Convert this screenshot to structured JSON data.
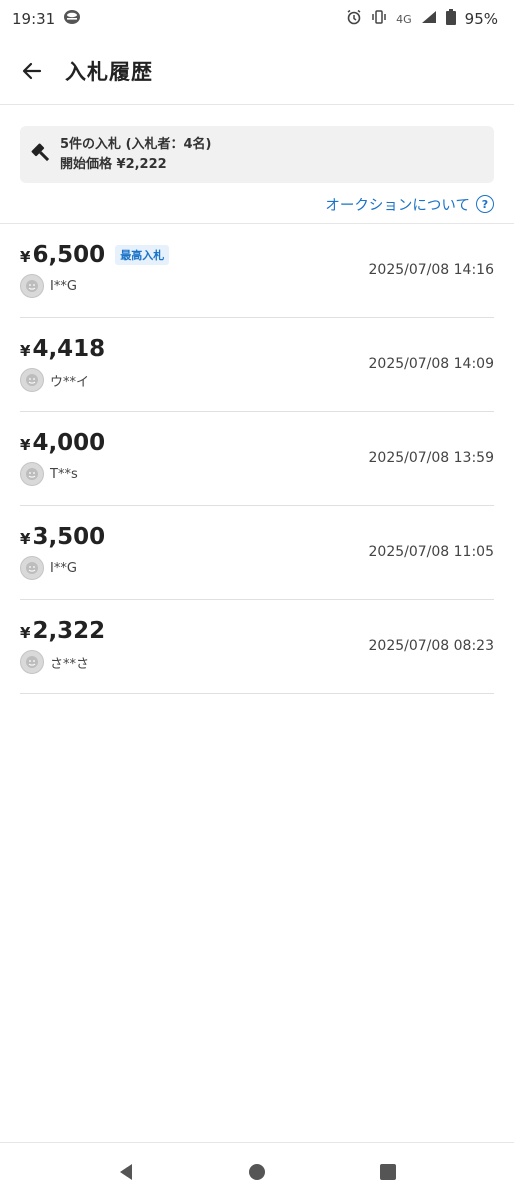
{
  "status_bar": {
    "time": "19:31",
    "network": "4G",
    "battery": "95%"
  },
  "header": {
    "title": "入札履歴"
  },
  "summary": {
    "line1": "5件の入札 (入札者：4名)",
    "line2": "開始価格 ¥2,222"
  },
  "auction_link": {
    "label": "オークションについて",
    "help": "?"
  },
  "bids": [
    {
      "yen": "¥",
      "amount": "6,500",
      "badge": "最高入札",
      "bidder": "I**G",
      "time": "2025/07/08 14:16"
    },
    {
      "yen": "¥",
      "amount": "4,418",
      "badge": "",
      "bidder": "ウ**イ",
      "time": "2025/07/08 14:09"
    },
    {
      "yen": "¥",
      "amount": "4,000",
      "badge": "",
      "bidder": "T**s",
      "time": "2025/07/08 13:59"
    },
    {
      "yen": "¥",
      "amount": "3,500",
      "badge": "",
      "bidder": "I**G",
      "time": "2025/07/08 11:05"
    },
    {
      "yen": "¥",
      "amount": "2,322",
      "badge": "",
      "bidder": "さ**さ",
      "time": "2025/07/08 08:23"
    }
  ],
  "colors": {
    "accent": "#1a73c8",
    "card_bg": "#f1f1f1",
    "badge_bg": "#e6f1fb"
  },
  "icons": [
    "clock-icon",
    "alarm-icon",
    "vibrate-icon",
    "signal-icon",
    "battery-icon",
    "back-arrow-icon",
    "gavel-icon",
    "help-icon",
    "avatar-icon",
    "nav-back-icon",
    "nav-home-icon",
    "nav-recents-icon"
  ]
}
